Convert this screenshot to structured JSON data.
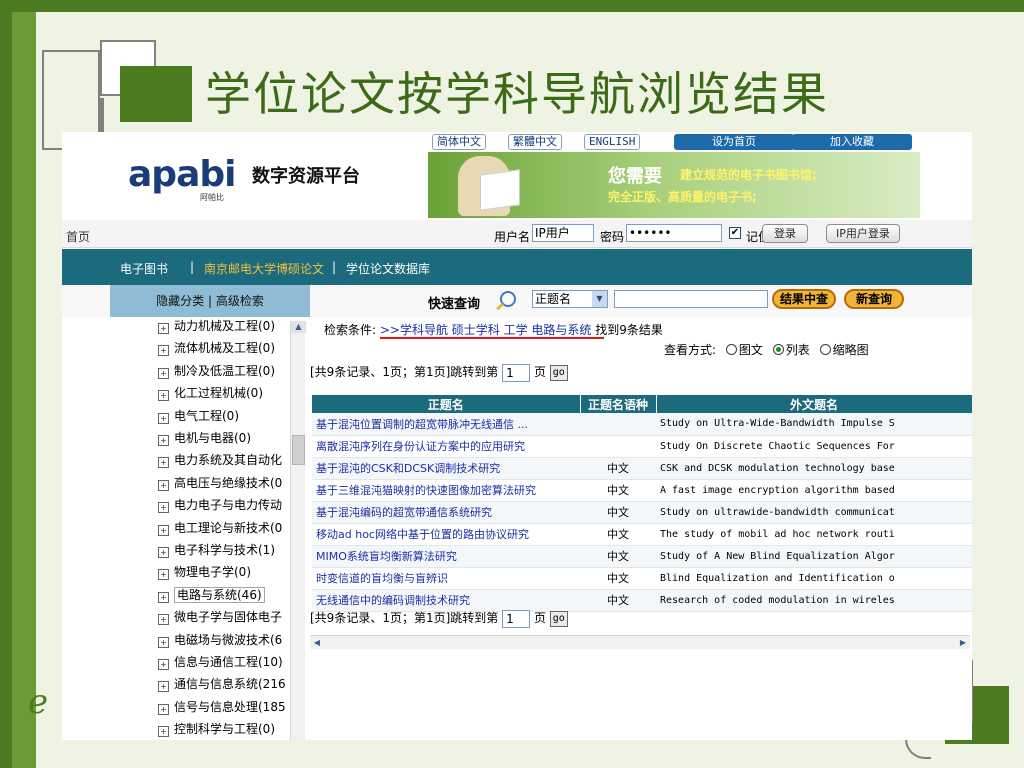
{
  "slide": {
    "title": "学位论文按学科导航浏览结果",
    "logo_glyph": "e"
  },
  "header": {
    "lang_links": [
      "简体中文",
      "繁體中文",
      "ENGLISH"
    ],
    "set_home": "设为首页",
    "add_favorite": "加入收藏",
    "logo": "apabi",
    "logo_sub": "阿帕比",
    "platform_name": "数字资源平台",
    "banner": {
      "line1": "您需要",
      "line1b": "建立规范的电子书图书馆;",
      "line2": "完全正版、高质量的电子书;"
    }
  },
  "loginbar": {
    "home": "首页",
    "username_label": "用户名",
    "username_value": "IP用户",
    "password_label": "密码",
    "password_value": "••••••",
    "remember": "记住我",
    "remember_checked": "✔",
    "login": "登录",
    "ip_login": "IP用户登录"
  },
  "nav": {
    "items": [
      "电子图书",
      "南京邮电大学博硕论文",
      "学位论文数据库"
    ],
    "separator": "|"
  },
  "search": {
    "left_head": "隐藏分类 | 高级检索",
    "quick_search": "快速查询",
    "field": "正题名",
    "query": "",
    "btn_within": "结果中查",
    "btn_new": "新查询"
  },
  "categories": [
    {
      "label": "动力机械及工程(0)",
      "box": "+"
    },
    {
      "label": "流体机械及工程(0)",
      "box": "+"
    },
    {
      "label": "制冷及低温工程(0)",
      "box": "+"
    },
    {
      "label": "化工过程机械(0)",
      "box": "+"
    },
    {
      "label": "电气工程(0)",
      "box": "+"
    },
    {
      "label": "电机与电器(0)",
      "box": "+"
    },
    {
      "label": "电力系统及其自动化",
      "box": "+"
    },
    {
      "label": "高电压与绝缘技术(0",
      "box": "+"
    },
    {
      "label": "电力电子与电力传动",
      "box": "+"
    },
    {
      "label": "电工理论与新技术(0",
      "box": "+"
    },
    {
      "label": "电子科学与技术(1)",
      "box": "+"
    },
    {
      "label": "物理电子学(0)",
      "box": "+"
    },
    {
      "label": "电路与系统(46)",
      "box": "+"
    },
    {
      "label": "微电子学与固体电子",
      "box": "+"
    },
    {
      "label": "电磁场与微波技术(6",
      "box": "+"
    },
    {
      "label": "信息与通信工程(10)",
      "box": "+"
    },
    {
      "label": "通信与信息系统(216",
      "box": "+"
    },
    {
      "label": "信号与信息处理(185",
      "box": "+"
    },
    {
      "label": "控制科学与工程(0)",
      "box": "+"
    }
  ],
  "results": {
    "condition_label": "检索条件:",
    "condition_path": ">>学科导航 硕士学科 工学 电路与系统",
    "found": "找到9条结果",
    "view_label": "查看方式:",
    "view_options": [
      "图文",
      "列表",
      "缩略图"
    ],
    "paging_prefix": "[共9条记录、1页；第1页]跳转到第",
    "paging_page": "1",
    "paging_suffix": "页",
    "go": "go",
    "columns": [
      "正题名",
      "正题名语种",
      "外文题名"
    ],
    "rows": [
      {
        "title": "基于混沌位置调制的超宽带脉冲无线通信 ...",
        "lang": "",
        "foreign": "Study on Ultra-Wide-Bandwidth Impulse S"
      },
      {
        "title": "离散混沌序列在身份认证方案中的应用研究",
        "lang": "",
        "foreign": "Study On Discrete Chaotic Sequences For"
      },
      {
        "title": "基于混沌的CSK和DCSK调制技术研究",
        "lang": "中文",
        "foreign": "CSK and DCSK modulation technology base"
      },
      {
        "title": "基于三维混沌猫映射的快速图像加密算法研究",
        "lang": "中文",
        "foreign": "A fast image encryption algorithm based"
      },
      {
        "title": "基于混沌编码的超宽带通信系统研究",
        "lang": "中文",
        "foreign": "Study on ultrawide-bandwidth communicat"
      },
      {
        "title": "移动ad hoc网络中基于位置的路由协议研究",
        "lang": "中文",
        "foreign": "The study of mobil ad hoc network routi"
      },
      {
        "title": "MIMO系统盲均衡新算法研究",
        "lang": "中文",
        "foreign": "Study of A New Blind Equalization Algor"
      },
      {
        "title": "时变信道的盲均衡与盲辨识",
        "lang": "中文",
        "foreign": "Blind Equalization and Identification o"
      },
      {
        "title": "无线通信中的编码调制技术研究",
        "lang": "中文",
        "foreign": "Research of coded modulation in wireles"
      }
    ]
  },
  "colors": {
    "slide_green": "#4d7c20",
    "nav_teal": "#1c6a7e",
    "link_blue": "#1a2ea6",
    "accent_orange": "#f0b43a",
    "underline_red": "#e01818"
  }
}
